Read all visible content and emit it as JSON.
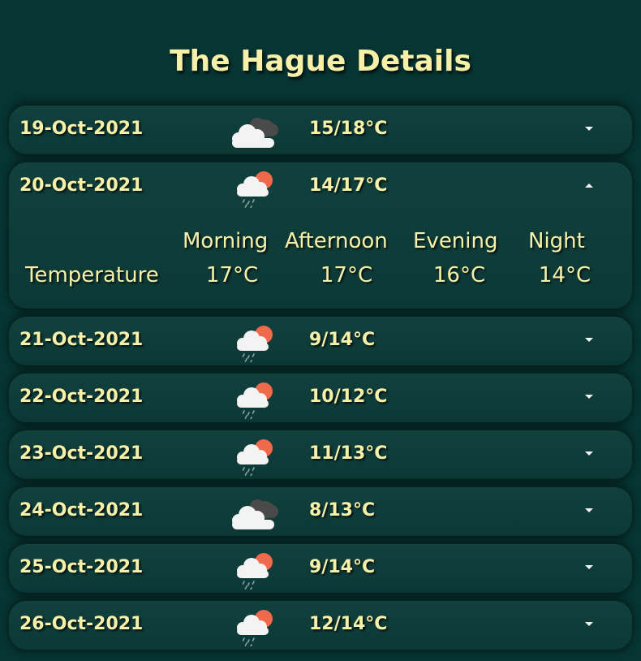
{
  "page": {
    "title": "The Hague Details"
  },
  "colors": {
    "background": "#073532",
    "card": "#0e3d3a",
    "text": "#f6f0a8",
    "sun": "#ef6a4a",
    "cloud_light": "#f3f3f3",
    "cloud_dark": "#4a4a4a"
  },
  "days": [
    {
      "date": "19-Oct-2021",
      "icon": "cloudy-icon",
      "temp": "15/18°C",
      "expanded": false
    },
    {
      "date": "20-Oct-2021",
      "icon": "sun-cloud-rain-icon",
      "temp": "14/17°C",
      "expanded": true,
      "details": {
        "columns": [
          "Morning",
          "Afternoon",
          "Evening",
          "Night"
        ],
        "row_label": "Temperature",
        "values": [
          "17°C",
          "17°C",
          "16°C",
          "14°C"
        ]
      }
    },
    {
      "date": "21-Oct-2021",
      "icon": "sun-cloud-rain-icon",
      "temp": "9/14°C",
      "expanded": false
    },
    {
      "date": "22-Oct-2021",
      "icon": "sun-cloud-rain-icon",
      "temp": "10/12°C",
      "expanded": false
    },
    {
      "date": "23-Oct-2021",
      "icon": "sun-cloud-rain-icon",
      "temp": "11/13°C",
      "expanded": false
    },
    {
      "date": "24-Oct-2021",
      "icon": "cloudy-icon",
      "temp": "8/13°C",
      "expanded": false
    },
    {
      "date": "25-Oct-2021",
      "icon": "sun-cloud-rain-icon",
      "temp": "9/14°C",
      "expanded": false
    },
    {
      "date": "26-Oct-2021",
      "icon": "sun-cloud-rain-icon",
      "temp": "12/14°C",
      "expanded": false
    }
  ]
}
